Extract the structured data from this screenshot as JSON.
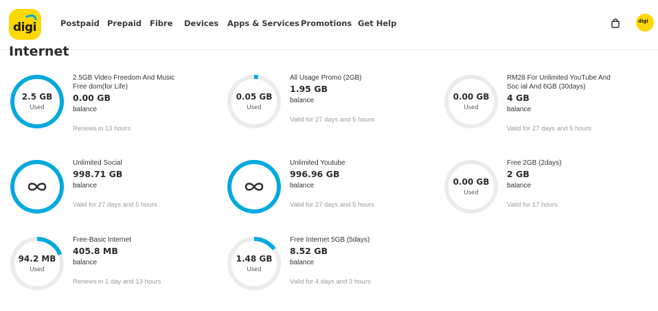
{
  "brand": {
    "logo_text": "digi",
    "accent_yellow": "#ffd800",
    "accent_blue": "#00a9e0",
    "ring_track": "#ececec"
  },
  "nav": {
    "items": [
      {
        "label": "Postpaid"
      },
      {
        "label": "Prepaid"
      },
      {
        "label": "Fibre"
      },
      {
        "label": "Devices"
      },
      {
        "label": "Apps & Services"
      },
      {
        "label": "Promotions"
      },
      {
        "label": "Get Help"
      }
    ],
    "cart_icon": "shopping-bag-icon",
    "avatar_text": "digi"
  },
  "section_title": "Internet",
  "plans": [
    {
      "name": "2.5GB Video Freedom And Music Free dom(for Life)",
      "ring_amount": "2.5 GB",
      "ring_used": "Used",
      "amount": "0.00 GB",
      "balance_label": "balance",
      "validity": "Renews in 13 hours",
      "progress": 1.0
    },
    {
      "name": "All Usage Promo (2GB)",
      "ring_amount": "0.05 GB",
      "ring_used": "Used",
      "amount": "1.95 GB",
      "balance_label": "balance",
      "validity": "Valid for 27 days and 5 hours",
      "progress": 0.025
    },
    {
      "name": "RM28 For Unlimited YouTube And Soc ial And 6GB (30days)",
      "ring_amount": "0.00 GB",
      "ring_used": "Used",
      "amount": "4 GB",
      "balance_label": "balance",
      "validity": "Valid for 27 days and 5 hours",
      "progress": 0
    },
    {
      "name": "Unlimited Social",
      "ring_amount": "",
      "ring_used": "",
      "unlimited": true,
      "amount": "998.71 GB",
      "balance_label": "balance",
      "validity": "Valid for 27 days and 5 hours",
      "progress": 1.0
    },
    {
      "name": "Unlimited Youtube",
      "ring_amount": "",
      "ring_used": "",
      "unlimited": true,
      "amount": "996.96 GB",
      "balance_label": "balance",
      "validity": "Valid for 27 days and 5 hours",
      "progress": 1.0
    },
    {
      "name": "Free 2GB (2days)",
      "ring_amount": "0.00 GB",
      "ring_used": "Used",
      "amount": "2 GB",
      "balance_label": "balance",
      "validity": "Valid for 17 hours",
      "progress": 0
    },
    {
      "name": "Free-Basic Internet",
      "ring_amount": "94.2 MB",
      "ring_used": "Used",
      "amount": "405.8 MB",
      "balance_label": "balance",
      "validity": "Renews in 1 day and 13 hours",
      "progress": 0.19
    },
    {
      "name": "Free Internet 5GB (5days)",
      "ring_amount": "1.48 GB",
      "ring_used": "Used",
      "amount": "8.52 GB",
      "balance_label": "balance",
      "validity": "Valid for 4 days and 3 hours",
      "progress": 0.15
    }
  ]
}
